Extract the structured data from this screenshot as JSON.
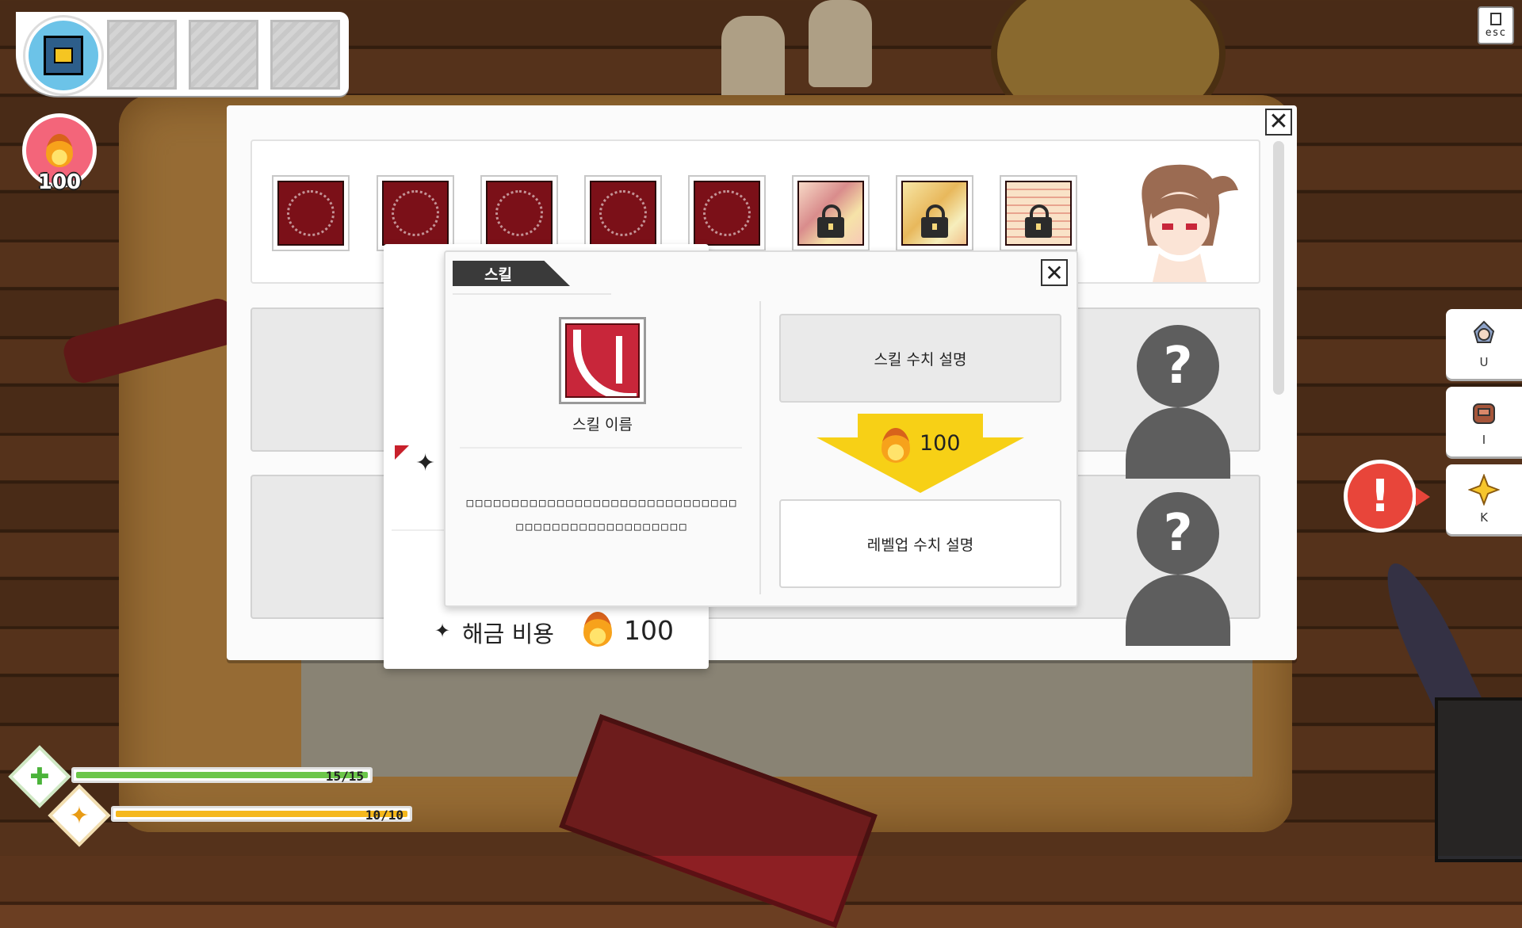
{
  "hud": {
    "currency_value": "100",
    "esc_label": "esc",
    "hp": {
      "current": 15,
      "max": 15,
      "label": "15/15",
      "fill": 1.0,
      "color": "#6cc64a"
    },
    "sp": {
      "current": 10,
      "max": 10,
      "label": "10/10",
      "fill": 1.0,
      "color": "#f5b81c"
    }
  },
  "side_menu": {
    "items": [
      {
        "key": "U",
        "icon": "character-icon"
      },
      {
        "key": "I",
        "icon": "bag-icon"
      },
      {
        "key": "K",
        "icon": "skill-star-icon"
      }
    ],
    "alert_symbol": "!"
  },
  "main_panel": {
    "close_symbol": "✕",
    "skills": [
      {
        "state": "unlocked",
        "icon": "crescent-slash-icon"
      },
      {
        "state": "unlocked",
        "icon": "swords-icon"
      },
      {
        "state": "unlocked",
        "icon": "demon-face-icon"
      },
      {
        "state": "unlocked",
        "icon": "army-icon"
      },
      {
        "state": "unlocked",
        "icon": "burst-icon"
      },
      {
        "state": "locked",
        "icon": "lock-icon"
      },
      {
        "state": "locked",
        "icon": "lock-icon"
      },
      {
        "state": "locked",
        "icon": "lock-icon"
      }
    ],
    "unknown_symbol": "?"
  },
  "unlock_cost": {
    "label": "해금 비용",
    "value": "100"
  },
  "skill_popup": {
    "tab_label": "스킬",
    "close_symbol": "✕",
    "skill_name": "스킬 이름",
    "description": "□□□□□□□□□□□□□□□□□□□□□□□□□□□□□□□□□□□□□□□□□□□□□□□□□",
    "current_stat_label": "스킬 수치 설명",
    "levelup_cost": "100",
    "next_stat_label": "레벨업 수치 설명"
  },
  "colors": {
    "accent_red": "#c8263a",
    "alert_red": "#e8453a",
    "arrow_yellow": "#f7d016"
  }
}
